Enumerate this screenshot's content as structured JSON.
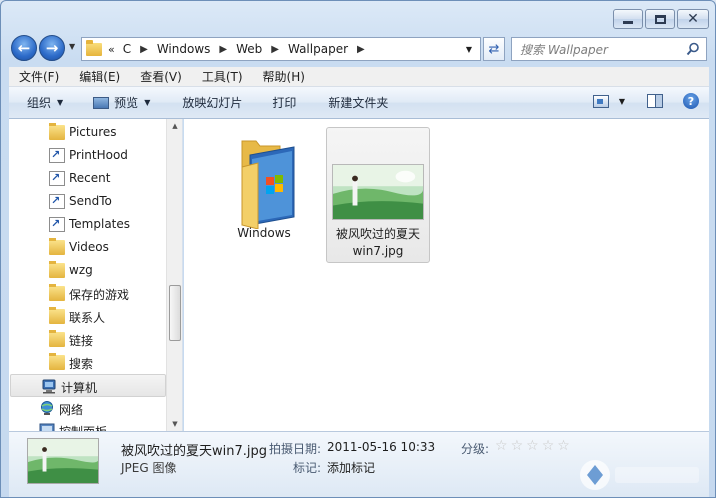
{
  "breadcrumb": {
    "more": "«",
    "items": [
      "C",
      "Windows",
      "Web",
      "Wallpaper"
    ]
  },
  "search": {
    "placeholder": "搜索 Wallpaper"
  },
  "menu": [
    "文件(F)",
    "编辑(E)",
    "查看(V)",
    "工具(T)",
    "帮助(H)"
  ],
  "toolbar": {
    "organize": "组织",
    "preview": "预览",
    "slideshow": "放映幻灯片",
    "print": "打印",
    "new_folder": "新建文件夹"
  },
  "nav": {
    "items": [
      {
        "label": "Pictures",
        "icon": "folder-icon"
      },
      {
        "label": "PrintHood",
        "icon": "shortcut-icon"
      },
      {
        "label": "Recent",
        "icon": "shortcut-icon"
      },
      {
        "label": "SendTo",
        "icon": "shortcut-icon"
      },
      {
        "label": "Templates",
        "icon": "shortcut-icon"
      },
      {
        "label": "Videos",
        "icon": "folder-icon"
      },
      {
        "label": "wzg",
        "icon": "folder-icon"
      },
      {
        "label": "保存的游戏",
        "icon": "folder-icon"
      },
      {
        "label": "联系人",
        "icon": "folder-icon"
      },
      {
        "label": "链接",
        "icon": "folder-icon"
      },
      {
        "label": "搜索",
        "icon": "folder-icon"
      }
    ],
    "computer": "计算机",
    "network": "网络",
    "control_panel": "控制面板"
  },
  "files": [
    {
      "name": "Windows",
      "type": "folder"
    },
    {
      "name": "被风吹过的夏天win7.jpg",
      "name_line1": "被风吹过的夏天",
      "name_line2": "win7.jpg",
      "type": "image"
    }
  ],
  "details": {
    "name": "被风吹过的夏天win7.jpg",
    "type": "JPEG 图像",
    "date_label": "拍摄日期:",
    "date_value": "2011-05-16 10:33",
    "tags_label": "标记:",
    "tags_value": "添加标记",
    "rating_label": "分级:",
    "rating": 0
  },
  "colors": {
    "accent": "#2d6bc9",
    "selection": "#e8e8e8",
    "command_bar": "#dfe9f5"
  }
}
